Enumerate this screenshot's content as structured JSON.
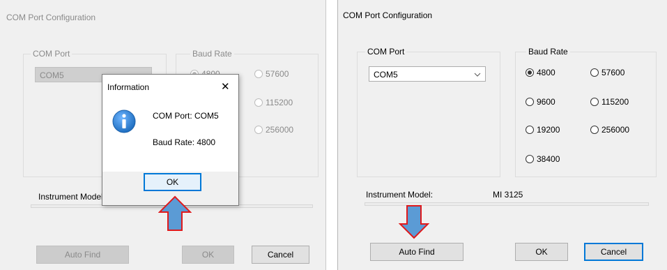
{
  "left_dialog": {
    "title": "COM Port  Configuration",
    "com_port_group": "COM Port",
    "com_port_value": "COM5",
    "baud_rate_group": "Baud Rate",
    "baud_rates": [
      "4800",
      "57600",
      "115200",
      "256000"
    ],
    "instrument_model_label": "Instrument Model:",
    "auto_find": "Auto Find",
    "ok": "OK",
    "cancel": "Cancel"
  },
  "info_popup": {
    "title": "Information",
    "close": "✕",
    "line1": "COM Port:  COM5",
    "line2": "Baud Rate:  4800",
    "ok": "OK",
    "icon": "info-icon"
  },
  "right_dialog": {
    "title": "COM Port  Configuration",
    "com_port_group": "COM Port",
    "com_port_value": "COM5",
    "baud_rate_group": "Baud Rate",
    "baud_rates": [
      "4800",
      "57600",
      "9600",
      "115200",
      "19200",
      "256000",
      "38400"
    ],
    "selected_baud": "4800",
    "instrument_model_label": "Instrument Model:",
    "instrument_model_value": "MI 3125",
    "auto_find": "Auto Find",
    "ok": "OK",
    "cancel": "Cancel"
  },
  "colors": {
    "dialog_bg": "#f0f0f0",
    "arrow_fill": "#5b9bd5",
    "arrow_stroke": "#e0191b",
    "info_blue": "#1f6fc1",
    "focus_blue": "#0078d7"
  }
}
